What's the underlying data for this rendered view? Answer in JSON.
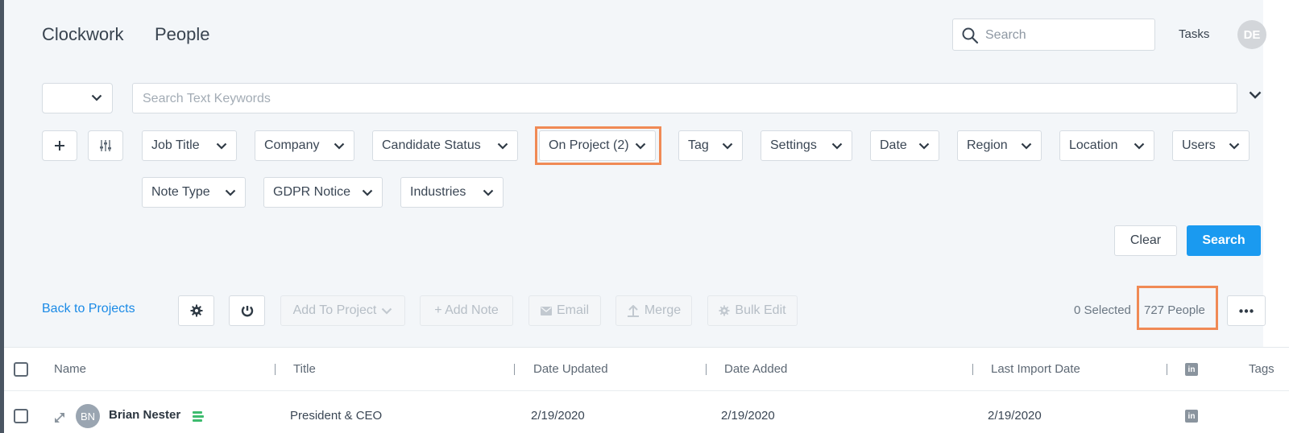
{
  "header": {
    "brand": "Clockwork",
    "section": "People",
    "search_placeholder": "Search",
    "tasks_label": "Tasks",
    "avatar_initials": "DE"
  },
  "keyword_search": {
    "select_value": "",
    "placeholder": "Search Text Keywords"
  },
  "filters": [
    {
      "label": "Job Title"
    },
    {
      "label": "Company"
    },
    {
      "label": "Candidate Status"
    },
    {
      "label": "On Project (2)"
    },
    {
      "label": "Tag"
    },
    {
      "label": "Settings"
    },
    {
      "label": "Date"
    },
    {
      "label": "Region"
    },
    {
      "label": "Location"
    },
    {
      "label": "Users"
    },
    {
      "label": "Note Type"
    },
    {
      "label": "GDPR Notice"
    },
    {
      "label": "Industries"
    }
  ],
  "actions": {
    "clear_label": "Clear",
    "search_label": "Search"
  },
  "toolbar": {
    "back_label": "Back to Projects",
    "add_to_project_label": "Add To Project",
    "add_note_label": "+ Add Note",
    "email_label": "Email",
    "merge_label": "Merge",
    "bulk_edit_label": "Bulk Edit",
    "selected_text": "0 Selected",
    "people_count_text": "727 People"
  },
  "table": {
    "columns": [
      "Name",
      "Title",
      "Date Updated",
      "Date Added",
      "Last Import Date",
      "Tags"
    ],
    "rows": [
      {
        "initials": "BN",
        "name": "Brian Nester",
        "title": "President & CEO",
        "date_updated": "2/19/2020",
        "date_added": "2/19/2020",
        "last_import_date": "2/19/2020"
      }
    ]
  },
  "colors": {
    "accent": "#1a9af0",
    "link": "#1a8ae6",
    "highlight": "#f08a55",
    "stack_icon": "#3dbb6e"
  }
}
